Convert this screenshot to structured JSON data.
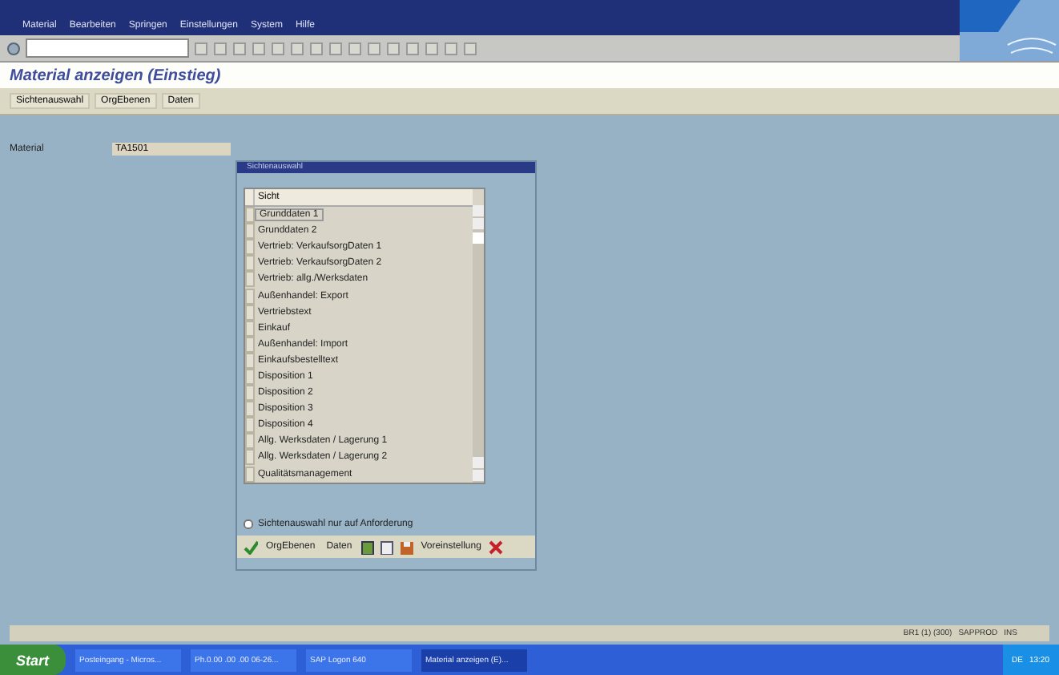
{
  "menu_bar": {
    "items": [
      "Material",
      "Bearbeiten",
      "Springen",
      "Einstellungen",
      "System",
      "Hilfe"
    ]
  },
  "screen_title": "Material anzeigen (Einstieg)",
  "app_toolbar": {
    "buttons": [
      "Sichtenauswahl",
      "OrgEbenen",
      "Daten"
    ]
  },
  "fields": [
    {
      "label": "Material",
      "value": "TA1501"
    }
  ],
  "dialog": {
    "title": "Sichtenauswahl",
    "column_header": "Sicht",
    "rows": [
      {
        "label": "Grunddaten 1",
        "selected": true
      },
      {
        "label": "Grunddaten 2",
        "selected": false
      },
      {
        "label": "Vertrieb: VerkaufsorgDaten 1",
        "selected": false
      },
      {
        "label": "Vertrieb: VerkaufsorgDaten 2",
        "selected": false
      },
      {
        "label": "Vertrieb: allg./Werksdaten",
        "selected": false
      },
      {
        "label": "Außenhandel: Export",
        "selected": false
      },
      {
        "label": "Vertriebstext",
        "selected": false
      },
      {
        "label": "Einkauf",
        "selected": false
      },
      {
        "label": "Außenhandel: Import",
        "selected": false
      },
      {
        "label": "Einkaufsbestelltext",
        "selected": false
      },
      {
        "label": "Disposition 1",
        "selected": false
      },
      {
        "label": "Disposition 2",
        "selected": false
      },
      {
        "label": "Disposition 3",
        "selected": false
      },
      {
        "label": "Disposition 4",
        "selected": false
      },
      {
        "label": "Allg. Werksdaten / Lagerung 1",
        "selected": false
      },
      {
        "label": "Allg. Werksdaten / Lagerung 2",
        "selected": false
      },
      {
        "label": "Qualitätsmanagement",
        "selected": false
      }
    ],
    "option": {
      "label": "Sichtenauswahl nur auf Anforderung",
      "checked": false
    },
    "buttons": [
      {
        "kind": "confirm"
      },
      {
        "kind": "text",
        "label": "OrgEbenen"
      },
      {
        "kind": "text",
        "label": "Daten"
      },
      {
        "kind": "select-all"
      },
      {
        "kind": "deselect"
      },
      {
        "kind": "save"
      },
      {
        "kind": "text",
        "label": "Voreinstellung"
      },
      {
        "kind": "cancel"
      }
    ]
  },
  "status_bar": {
    "system": "BR1 (1) (300)",
    "server": "SAPPROD",
    "mode": "INS"
  },
  "taskbar": {
    "start": "Start",
    "tasks": [
      {
        "label": "Posteingang - Micros...",
        "selected": false
      },
      {
        "label": "Ph.0.00 .00 .00 06-26...",
        "selected": false
      },
      {
        "label": "SAP Logon 640",
        "selected": false
      },
      {
        "label": "Material anzeigen (E)...",
        "selected": true
      }
    ],
    "tray": {
      "language": "DE",
      "time": "13:20"
    }
  }
}
